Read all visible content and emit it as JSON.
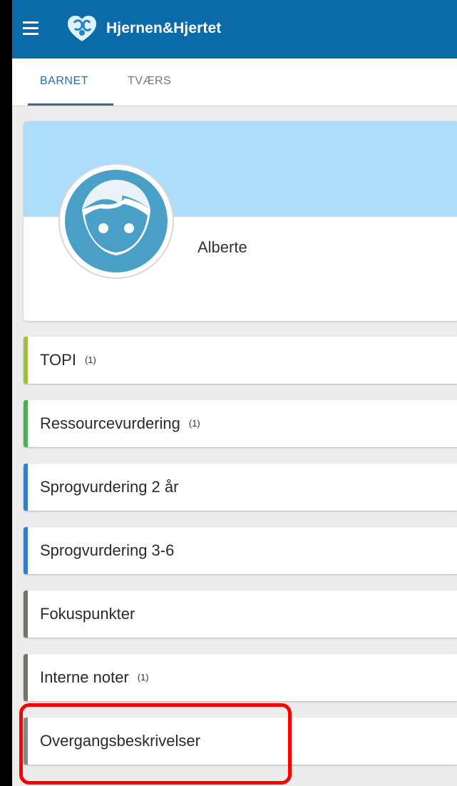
{
  "app": {
    "title": "Hjernen&Hjertet",
    "bar_color": "#0b6ba8"
  },
  "icons": {
    "menu": "hamburger-menu-icon",
    "logo": "heart-brain-logo-icon",
    "avatar": "child-face-avatar-icon"
  },
  "tabs": [
    {
      "label": "BARNET",
      "active": true
    },
    {
      "label": "TVÆRS",
      "active": false
    }
  ],
  "profile": {
    "name": "Alberte",
    "banner_color": "#aedcfb",
    "avatar_color": "#4a9fc6"
  },
  "sections": [
    {
      "label": "TOPI",
      "count": "(1)",
      "accent": "#9dc13a"
    },
    {
      "label": "Ressourcevurdering",
      "count": "(1)",
      "accent": "#4caf50"
    },
    {
      "label": "Sprogvurdering 2 år",
      "count": "",
      "accent": "#2f7fd6"
    },
    {
      "label": "Sprogvurdering 3-6",
      "count": "",
      "accent": "#2f7fd6"
    },
    {
      "label": "Fokuspunkter",
      "count": "",
      "accent": "#77746a"
    },
    {
      "label": "Interne noter",
      "count": "(1)",
      "accent": "#77746a"
    },
    {
      "label": "Overgangsbeskrivelser",
      "count": "",
      "accent": "#888888"
    }
  ],
  "highlight": {
    "target": "Overgangsbeskrivelser",
    "color": "#ff0000"
  }
}
